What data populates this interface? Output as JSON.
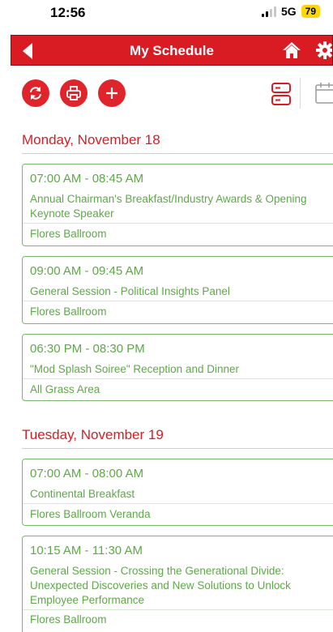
{
  "status_bar": {
    "time": "12:56",
    "network": "5G",
    "battery": "79"
  },
  "header": {
    "title": "My Schedule"
  },
  "toolbar": {
    "refresh_icon": "refresh-icon",
    "print_icon": "print-icon",
    "add_icon": "plus-icon",
    "list_view_icon": "list-view-icon",
    "calendar_view_icon": "calendar-icon"
  },
  "colors": {
    "brand_red": "#d91c24",
    "event_green": "#5fa84a",
    "event_border": "#7ab86c"
  },
  "days": [
    {
      "label": "Monday, November 18",
      "events": [
        {
          "time": "07:00 AM - 08:45 AM",
          "title": "Annual Chairman's Breakfast/Industry Awards & Opening Keynote Speaker",
          "location": "Flores Ballroom"
        },
        {
          "time": "09:00 AM - 09:45 AM",
          "title": "General Session - Political Insights Panel",
          "location": "Flores Ballroom"
        },
        {
          "time": "06:30 PM - 08:30 PM",
          "title": "\"Mod Splash Soiree\" Reception and Dinner",
          "location": "All Grass Area"
        }
      ]
    },
    {
      "label": "Tuesday, November 19",
      "events": [
        {
          "time": "07:00 AM - 08:00 AM",
          "title": "Continental Breakfast",
          "location": "Flores Ballroom Veranda"
        },
        {
          "time": "10:15 AM - 11:30 AM",
          "title": "General Session - Crossing the Generational Divide: Unexpected Discoveries and New Solutions to Unlock Employee Performance",
          "location": "Flores Ballroom"
        }
      ]
    }
  ]
}
